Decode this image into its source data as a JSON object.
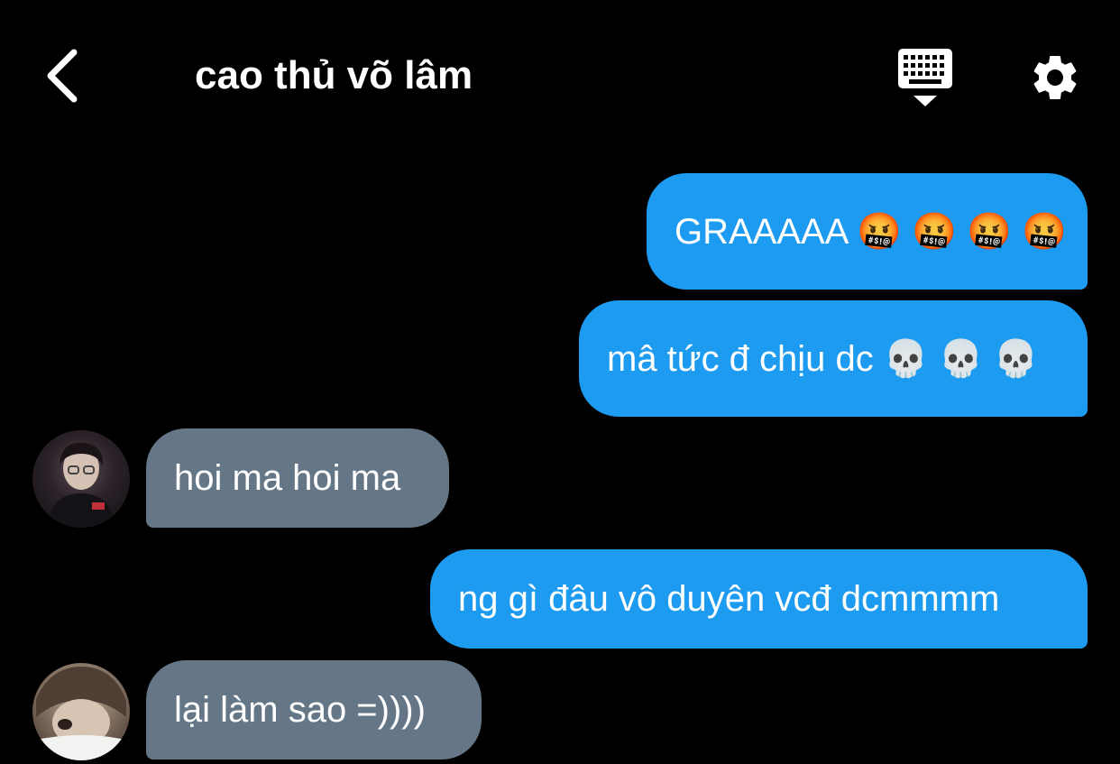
{
  "header": {
    "back_icon": "chevron-left-icon",
    "title": "cao thủ võ lâm",
    "keyboard_icon": "keyboard-icon",
    "settings_icon": "gear-icon"
  },
  "messages": [
    {
      "sender": "me",
      "text": "GRAAAAA 🤬 🤬 🤬 🤬"
    },
    {
      "sender": "me",
      "text": "mâ tức đ chịu dc 💀 💀 💀"
    },
    {
      "sender": "other",
      "text": "hoi ma hoi ma"
    },
    {
      "sender": "me",
      "text": "ng gì đâu vô duyên vcđ dcmmmm"
    },
    {
      "sender": "other",
      "text": "lại làm sao =))))"
    }
  ],
  "colors": {
    "background": "#000000",
    "outgoing_bubble": "#1d9bf0",
    "incoming_bubble": "#657786",
    "text": "#ffffff"
  }
}
